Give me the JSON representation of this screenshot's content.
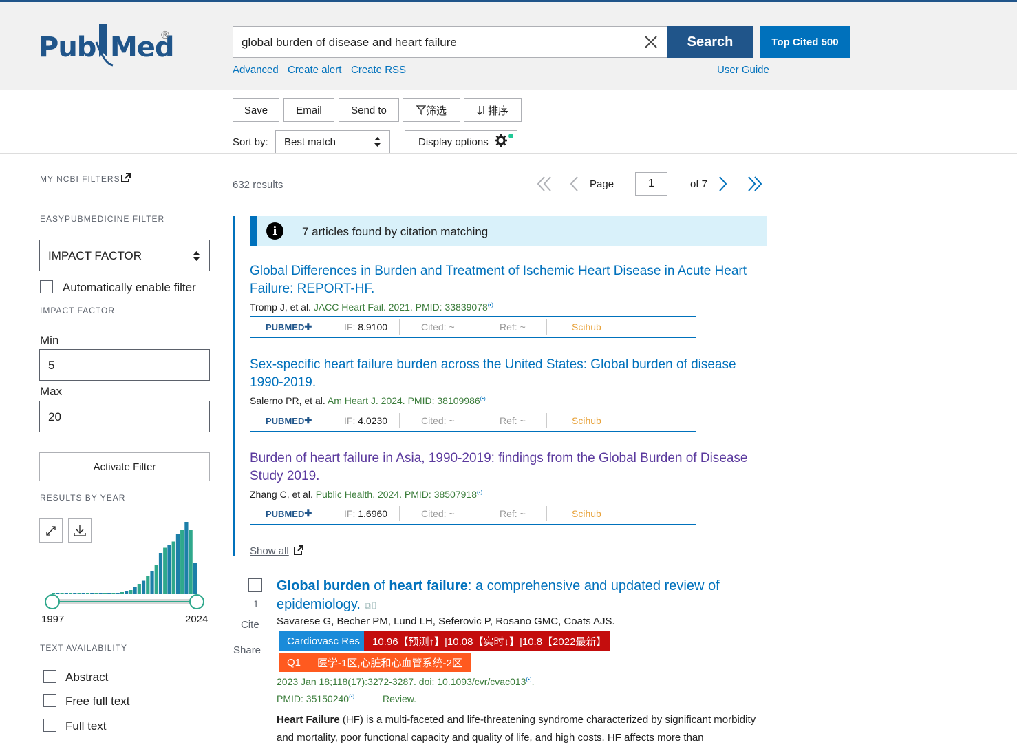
{
  "logo": {
    "pub": "Pub",
    "med": "Med",
    "reg": "®"
  },
  "search": {
    "query": "global burden of disease and heart failure",
    "button": "Search",
    "top_cited": "Top Cited 500"
  },
  "header_links": {
    "advanced": "Advanced",
    "create_alert": "Create alert",
    "create_rss": "Create RSS",
    "user_guide": "User Guide"
  },
  "toolbar": {
    "save": "Save",
    "email": "Email",
    "send_to": "Send to",
    "filter": "筛选",
    "sort": "排序",
    "sort_by_label": "Sort by:",
    "sort_value": "Best match",
    "display_options": "Display options"
  },
  "sidebar": {
    "my_ncbi_filters": "MY NCBI FILTERS",
    "easypubmedicine_filter": "EASYPUBMEDICINE FILTER",
    "filter_select": "IMPACT FACTOR",
    "auto_enable": "Automatically enable filter",
    "impact_factor": "IMPACT FACTOR",
    "min_label": "Min",
    "min_value": "5",
    "max_label": "Max",
    "max_value": "20",
    "activate": "Activate Filter",
    "results_by_year": "RESULTS BY YEAR",
    "year_start": "1997",
    "year_end": "2024",
    "text_availability": "TEXT AVAILABILITY",
    "abstract": "Abstract",
    "free_full_text": "Free full text",
    "full_text": "Full text"
  },
  "results": {
    "count": "632 results",
    "page_label": "Page",
    "page": "1",
    "of": "of 7"
  },
  "citation_match": {
    "notice": "7 articles found by citation matching",
    "articles": [
      {
        "title": "Global Differences in Burden and Treatment of Ischemic Heart Disease in Acute Heart Failure: REPORT-HF.",
        "authors": "Tromp J, et al.",
        "journal": "JACC Heart Fail. 2021. PMID: 33839078",
        "if_label": "IF:",
        "if_value": "8.9100",
        "cited": "Cited: ~",
        "ref": "Ref: ~",
        "scihub": "Scihub"
      },
      {
        "title": "Sex-specific heart failure burden across the United States: Global burden of disease 1990-2019.",
        "authors": "Salerno PR, et al.",
        "journal": "Am Heart J. 2024. PMID: 38109986",
        "if_label": "IF:",
        "if_value": "4.0230",
        "cited": "Cited: ~",
        "ref": "Ref: ~",
        "scihub": "Scihub"
      },
      {
        "title": "Burden of heart failure in Asia, 1990-2019: findings from the Global Burden of Disease Study 2019.",
        "authors": "Zhang C, et al.",
        "journal": "Public Health. 2024. PMID: 38507918",
        "if_label": "IF:",
        "if_value": "1.6960",
        "cited": "Cited: ~",
        "ref": "Ref: ~",
        "scihub": "Scihub"
      }
    ],
    "pubmed_label": "PUBMED",
    "show_all": "Show all"
  },
  "result1": {
    "number": "1",
    "cite": "Cite",
    "share": "Share",
    "title_b1": "Global burden",
    "title_t1": " of ",
    "title_b2": "heart failure",
    "title_t2": ": a comprehensive and updated review of epidemiology.",
    "authors": "Savarese G, Becher PM, Lund LH, Seferovic P, Rosano GMC, Coats AJS.",
    "journal_tag": "Cardiovasc Res",
    "if_tag": "10.96【预测↑】|10.08【实时↓】|10.8【2022最新】",
    "q_tag": "Q1",
    "cas_tag": "医学-1区,心脏和心血管系统-2区",
    "citation": "2023 Jan 18;118(17):3272-3287. doi: 10.1093/cvr/cvac013",
    "pmid": "PMID: 35150240",
    "review": "Review.",
    "snippet_b": "Heart Failure",
    "snippet": " (HF) is a multi-faceted and life-threatening syndrome characterized by significant morbidity and mortality, poor functional capacity and quality of life, and high costs. HF affects more than"
  },
  "chart_data": {
    "type": "bar",
    "title": "",
    "x": [
      1997,
      2024
    ],
    "values": [
      1,
      1,
      1,
      1,
      1,
      1,
      1,
      1,
      1,
      1,
      1,
      1,
      1,
      1,
      1,
      1,
      2,
      3,
      4,
      7,
      10,
      13,
      18,
      22,
      28,
      40,
      45,
      48,
      51,
      58,
      62,
      70,
      62,
      30
    ],
    "note_colors": [
      "#1c7fa8",
      "#2fa88c"
    ]
  }
}
